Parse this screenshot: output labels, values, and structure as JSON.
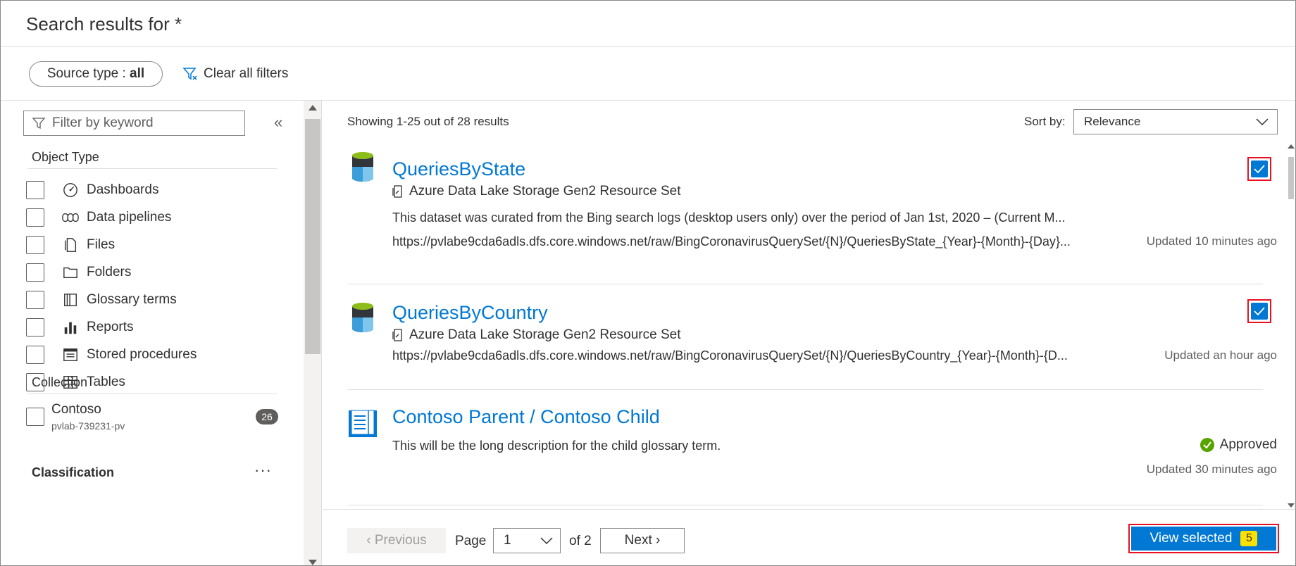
{
  "header": {
    "title": "Search results for *"
  },
  "filters": {
    "source_type_label": "Source type : ",
    "source_type_value": "all",
    "clear_all": "Clear all filters"
  },
  "sidebar": {
    "keyword_placeholder": "Filter by keyword",
    "object_type_title": "Object Type",
    "object_types": [
      {
        "label": "Dashboards",
        "icon": "dashboard-icon"
      },
      {
        "label": "Data pipelines",
        "icon": "pipeline-icon"
      },
      {
        "label": "Files",
        "icon": "file-icon"
      },
      {
        "label": "Folders",
        "icon": "folder-icon"
      },
      {
        "label": "Glossary terms",
        "icon": "glossary-icon"
      },
      {
        "label": "Reports",
        "icon": "report-icon"
      },
      {
        "label": "Stored procedures",
        "icon": "stored-procedure-icon"
      },
      {
        "label": "Tables",
        "icon": "table-icon"
      }
    ],
    "collection_title": "Collection",
    "collection": {
      "name": "Contoso",
      "sub": "pvlab-739231-pv",
      "count": "26"
    },
    "classification_title": "Classification",
    "more_label": "···"
  },
  "main": {
    "showing": "Showing 1-25 out of 28 results",
    "sort_label": "Sort by:",
    "sort_value": "Relevance",
    "results": [
      {
        "title": "QueriesByState",
        "type": "Azure Data Lake Storage Gen2 Resource Set",
        "desc": "This dataset was curated from the Bing search logs (desktop users only) over the period of Jan 1st, 2020 – (Current M...",
        "url": "https://pvlabe9cda6adls.dfs.core.windows.net/raw/BingCoronavirusQuerySet/{N}/QueriesByState_{Year}-{Month}-{Day}...",
        "updated": "Updated 10 minutes ago",
        "selected": true
      },
      {
        "title": "QueriesByCountry",
        "type": "Azure Data Lake Storage Gen2 Resource Set",
        "url": "https://pvlabe9cda6adls.dfs.core.windows.net/raw/BingCoronavirusQuerySet/{N}/QueriesByCountry_{Year}-{Month}-{D...",
        "updated": "Updated an hour ago",
        "selected": true
      },
      {
        "title": "Contoso Parent / Contoso Child",
        "desc": "This will be the long description for the child glossary term.",
        "status": "Approved",
        "updated": "Updated 30 minutes ago"
      }
    ]
  },
  "footer": {
    "previous": "‹ Previous",
    "page_label": "Page",
    "page_value": "1",
    "of_label": "of 2",
    "next": "Next ›",
    "view_selected": "View selected",
    "selected_count": "5"
  },
  "colors": {
    "accent": "#0078d4",
    "highlight": "#e81123",
    "badge": "#fce100",
    "approved": "#57a300"
  }
}
